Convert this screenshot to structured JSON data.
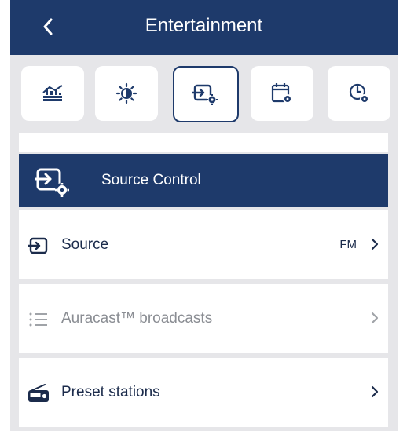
{
  "header": {
    "title": "Entertainment"
  },
  "colors": {
    "primary": "#1e3a6b",
    "background": "#e6e6e9",
    "disabled": "#a0a3a8"
  },
  "tabs": [
    {
      "icon": "equalizer-icon",
      "active": false
    },
    {
      "icon": "brightness-icon",
      "active": false
    },
    {
      "icon": "source-settings-icon",
      "active": true
    },
    {
      "icon": "calendar-settings-icon",
      "active": false
    },
    {
      "icon": "clock-settings-icon",
      "active": false
    }
  ],
  "section": {
    "title": "Source Control",
    "icon": "source-settings-icon"
  },
  "rows": [
    {
      "label": "Source",
      "value": "FM",
      "icon": "source-input-icon",
      "enabled": true
    },
    {
      "label": "Auracast™ broadcasts",
      "icon": "list-icon",
      "enabled": false
    },
    {
      "label": "Preset stations",
      "icon": "radio-icon",
      "enabled": true
    }
  ]
}
